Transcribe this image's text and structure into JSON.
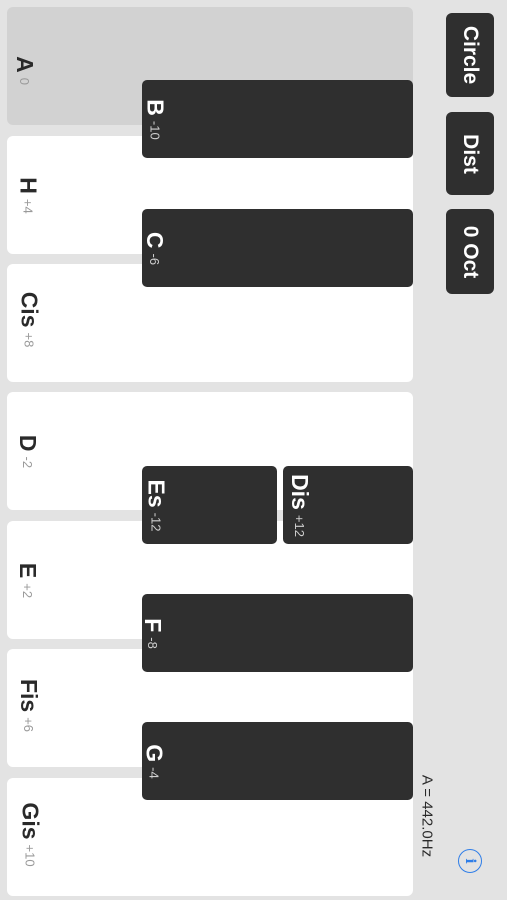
{
  "white_keys": [
    {
      "name": "A",
      "cents": "0",
      "active": true
    },
    {
      "name": "H",
      "cents": "+4"
    },
    {
      "name": "Cis",
      "cents": "+8"
    },
    {
      "name": "D",
      "cents": "-2"
    },
    {
      "name": "E",
      "cents": "+2"
    },
    {
      "name": "Fis",
      "cents": "+6"
    },
    {
      "name": "Gis",
      "cents": "+10"
    }
  ],
  "black_keys": [
    {
      "name": "B",
      "cents": "-10"
    },
    {
      "name": "C",
      "cents": "-6"
    },
    {
      "name": "Es",
      "cents": "-12"
    },
    {
      "name": "Dis",
      "cents": "+12"
    },
    {
      "name": "F",
      "cents": "-8"
    },
    {
      "name": "G",
      "cents": "-4"
    }
  ],
  "buttons": {
    "circle": "Circle",
    "dist": "Dist",
    "octave": "0 Oct"
  },
  "reference": "A = 442.0Hz",
  "info_glyph": "i",
  "colors": {
    "black_key": "#2f2f2f",
    "white_key": "#ffffff",
    "active_key": "#d2d2d2",
    "accent": "#2f7ee8"
  }
}
